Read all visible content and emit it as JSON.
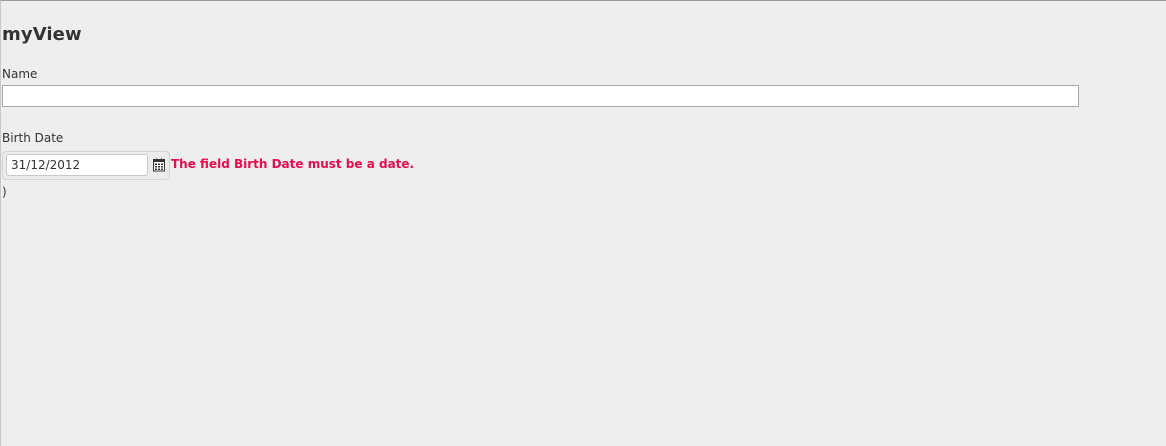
{
  "view": {
    "title": "myView"
  },
  "form": {
    "name_label": "Name",
    "name_value": "",
    "birth_label": "Birth Date",
    "birth_value": "31/12/2012",
    "error_message": "The field Birth Date must be a date.",
    "trailing_text": ")"
  },
  "icons": {
    "calendar": "calendar-icon"
  },
  "colors": {
    "error": "#e80c4d",
    "background": "#eeeeee"
  }
}
